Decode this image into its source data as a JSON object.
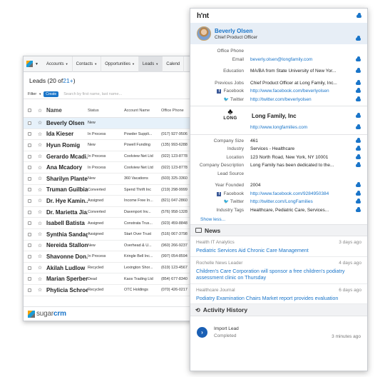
{
  "crm": {
    "nav": [
      "Accounts",
      "Contacts",
      "Opportunities",
      "Leads",
      "Calend"
    ],
    "title": "Leads (20 of ",
    "count": "21+",
    "title_end": ")",
    "filter_label": "Filter",
    "create_label": "Create",
    "search_placeholder": "Search by first name, last name...",
    "columns": [
      "Name",
      "Status",
      "Account Name",
      "Office Phone"
    ],
    "rows": [
      {
        "name": "Beverly Olsen",
        "status": "New",
        "account": "",
        "phone": ""
      },
      {
        "name": "Ida Kieser",
        "status": "In Process",
        "account": "Powder Suppli...",
        "phone": "(017) 927-9506"
      },
      {
        "name": "Hyun Romig",
        "status": "New",
        "account": "Powell Funding",
        "phone": "(135) 993-6288"
      },
      {
        "name": "Gerardo Mcadi...",
        "status": "In Process",
        "account": "Coolview Net Ltd",
        "phone": "(922) 123-8778"
      },
      {
        "name": "Ana Mcadory",
        "status": "In Process",
        "account": "Coolview Net Ltd",
        "phone": "(922) 123-8778"
      },
      {
        "name": "Sharilyn Plante",
        "status": "New",
        "account": "360 Vacations",
        "phone": "(603) 325-3360"
      },
      {
        "name": "Truman Guilbia...",
        "status": "Converted",
        "account": "Spend Thrift Inc",
        "phone": "(219) 298-9999"
      },
      {
        "name": "Dr. Hye Kamin...",
        "status": "Assigned",
        "account": "Income Free In...",
        "phone": "(821) 047-2860"
      },
      {
        "name": "Dr. Marietta Jia...",
        "status": "Converted",
        "account": "Davenport Inv...",
        "phone": "(576) 958-1328"
      },
      {
        "name": "Isabell Batista",
        "status": "Assigned",
        "account": "Constrata Trus...",
        "phone": "(923) 459-8848"
      },
      {
        "name": "Synthia Sandage",
        "status": "Assigned",
        "account": "Start Over Trust",
        "phone": "(516) 067-3798"
      },
      {
        "name": "Nereida Stallone",
        "status": "New",
        "account": "Overhead & U...",
        "phone": "(960) 266-9237"
      },
      {
        "name": "Shavonne Don...",
        "status": "In Process",
        "account": "Kringle Bell Inc...",
        "phone": "(997) 054-8594"
      },
      {
        "name": "Akilah Ludlow",
        "status": "Recycled",
        "account": "Lexington Shor...",
        "phone": "(619) 123-4567"
      },
      {
        "name": "Marian Sperber",
        "status": "Dead",
        "account": "Kaos Trading Ltd",
        "phone": "(854) 677-8340"
      },
      {
        "name": "Phylicia Schroe...",
        "status": "Recycled",
        "account": "OTC Holdings",
        "phone": "(070) 426-0217"
      }
    ],
    "brand_a": "sugar",
    "brand_b": "crm"
  },
  "hint": {
    "logo": "h'nt",
    "person": {
      "name": "Beverly Olsen",
      "title": "Chief Product Officer"
    },
    "fields": [
      {
        "k": "Office Phone",
        "v": "",
        "link": false
      },
      {
        "k": "Email",
        "v": "beverly.olsen@longfamily.com",
        "link": true
      },
      {
        "k": "Education",
        "v": "MA/BA from State University of New Yor...",
        "link": false
      },
      {
        "k": "Previous Jobs",
        "v": "Chief Product Officer at Long Family, Inc...",
        "link": false
      },
      {
        "k": "Facebook",
        "v": "http://www.facebook.com/beverlyolsen",
        "link": true
      },
      {
        "k": "Twitter",
        "v": "http://twitter.com/beverlyolsen",
        "link": true
      }
    ],
    "company": {
      "logo_text": "LONG",
      "name": "Long Family, Inc",
      "website": "http://www.longfamilies.com"
    },
    "company_fields": [
      {
        "k": "Company Size",
        "v": "461",
        "link": false
      },
      {
        "k": "Industry",
        "v": "Services - Healthcare",
        "link": false
      },
      {
        "k": "Location",
        "v": "123 North Road, New York, NY 10001",
        "link": false
      },
      {
        "k": "Company Description",
        "v": "Long Family has been dedicated to the...",
        "link": false
      },
      {
        "k": "Lead Source",
        "v": "",
        "link": false
      },
      {
        "k": "Year Founded",
        "v": "2004",
        "link": false
      },
      {
        "k": "Facebook",
        "v": "http://www.facebook.com/9284950384",
        "link": true
      },
      {
        "k": "Twitter",
        "v": "http://twitter.com/LongFamilies",
        "link": true
      },
      {
        "k": "Industry Tags",
        "v": "Healthcare, Pediatric Care, Services...",
        "link": false
      }
    ],
    "show_less": "Show less...",
    "news_label": "News",
    "news": [
      {
        "source": "Health IT Analytics",
        "time": "3 days ago",
        "title": "Pediatric Services Aid Chronic Care Management"
      },
      {
        "source": "Rochelle News Leader",
        "time": "4 days ago",
        "title": "Children's Care Corporation will sponsor a free children's podiatry assessment clinic on Thursday"
      },
      {
        "source": "Healthcare Journal",
        "time": "6 days ago",
        "title": "Podiatry Examination Chairs Market report provides evaluation"
      }
    ],
    "activity_label": "Activity History",
    "activity": {
      "title": "Import Lead",
      "sub": "Completed",
      "time": "3 minutes ago"
    }
  }
}
